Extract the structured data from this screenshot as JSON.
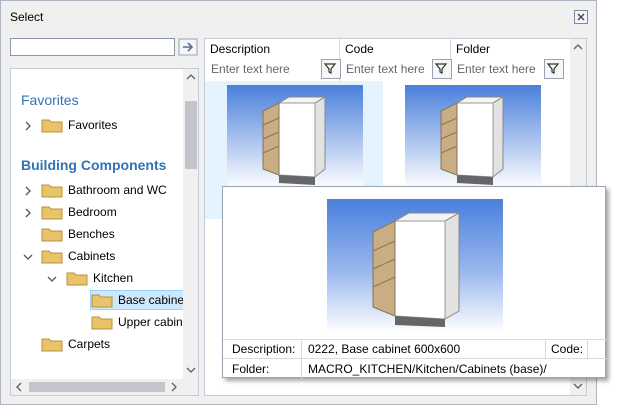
{
  "window": {
    "title": "Select"
  },
  "search": {
    "value": "",
    "placeholder": ""
  },
  "tree": {
    "groups": [
      {
        "heading": "Favorites",
        "items": [
          {
            "label": "Favorites",
            "expanded": false
          }
        ]
      },
      {
        "heading": "Building Components",
        "items": [
          {
            "label": "Bathroom and WC",
            "expanded": false
          },
          {
            "label": "Bedroom",
            "expanded": false
          },
          {
            "label": "Benches",
            "expanded": null
          },
          {
            "label": "Cabinets",
            "expanded": true
          },
          {
            "label": "Kitchen",
            "expanded": true
          },
          {
            "label": "Base cabinet",
            "selected": true
          },
          {
            "label": "Upper cabin"
          },
          {
            "label": "Carpets",
            "expanded": null
          }
        ]
      }
    ]
  },
  "grid": {
    "columns": [
      {
        "title": "Description",
        "filter_placeholder": "Enter text here"
      },
      {
        "title": "Code",
        "filter_placeholder": "Enter text here"
      },
      {
        "title": "Folder",
        "filter_placeholder": "Enter text here"
      }
    ]
  },
  "popup": {
    "description_label": "Description:",
    "description_value": "0222, Base cabinet 600x600",
    "code_label": "Code:",
    "code_value": "",
    "folder_label": "Folder:",
    "folder_value": "MACRO_KITCHEN/Kitchen/Cabinets (base)/"
  },
  "colors": {
    "heading": "#3373b4",
    "selection": "#cce8ff",
    "thumb_sky": "#4a7fdc",
    "folder": "#e8c36a"
  },
  "icons": {
    "close": "close-icon",
    "go": "arrow-right-icon",
    "filter": "filter-icon",
    "folder": "folder-icon"
  }
}
